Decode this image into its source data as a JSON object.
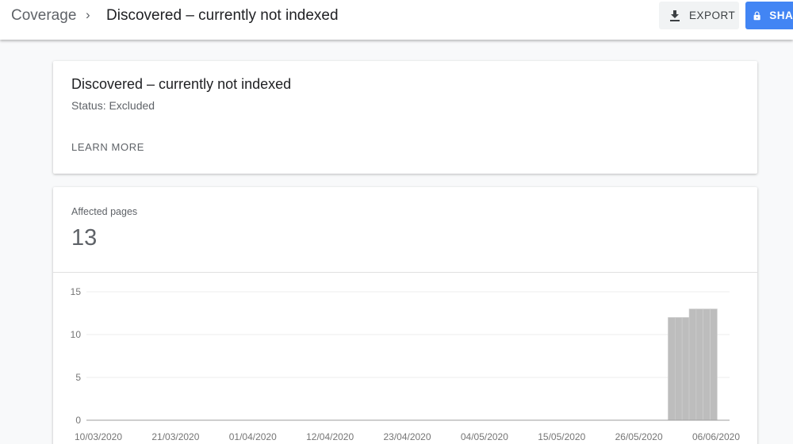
{
  "header": {
    "breadcrumb_root": "Coverage",
    "breadcrumb_separator": "›",
    "breadcrumb_current": "Discovered – currently not indexed",
    "export_label": "EXPORT",
    "export_icon": "download-icon",
    "share_label": "SHARE",
    "share_icon": "lock-icon"
  },
  "issue_card": {
    "title": "Discovered – currently not indexed",
    "status": "Status: Excluded",
    "learn_more": "LEARN MORE"
  },
  "affected_card": {
    "label": "Affected pages",
    "value": "13"
  },
  "colors": {
    "accent": "#4285f4",
    "bar": "#bdbdbd",
    "gridline": "#eeeeee",
    "axis_text": "#757575"
  },
  "chart_data": {
    "type": "bar",
    "title": "",
    "xlabel": "",
    "ylabel": "",
    "ylim": [
      0,
      15
    ],
    "yticks": [
      0,
      5,
      10,
      15
    ],
    "grid": true,
    "x_start": "10/03/2020",
    "x_end": "06/06/2020",
    "xtick_labels": [
      "10/03/2020",
      "21/03/2020",
      "01/04/2020",
      "12/04/2020",
      "23/04/2020",
      "04/05/2020",
      "15/05/2020",
      "26/05/2020",
      "06/06/2020"
    ],
    "categories": [
      "31/05/2020",
      "01/06/2020",
      "02/06/2020",
      "03/06/2020",
      "04/06/2020",
      "05/06/2020",
      "06/06/2020"
    ],
    "values": [
      12,
      12,
      12,
      13,
      13,
      13,
      13
    ],
    "note": "All earlier dates from 10/03/2020 to 30/05/2020 have value 0"
  }
}
